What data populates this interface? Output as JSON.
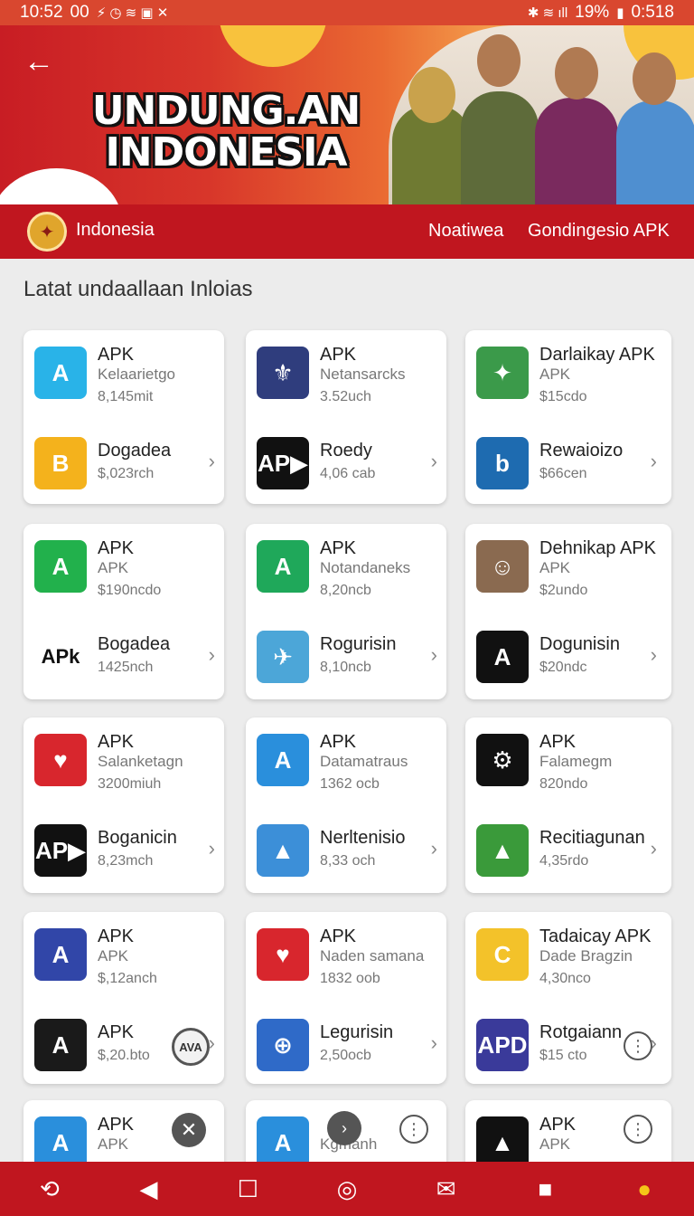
{
  "status": {
    "time": "10:52",
    "left_extra": "00",
    "battery": "19%",
    "right_time": "0:518"
  },
  "hero": {
    "title_line1": "UNDUNG.AN",
    "title_line2": "INDONESIA"
  },
  "nav": {
    "country": "Indonesia",
    "link1": "Noatiwea",
    "link2": "Gondingesio APK"
  },
  "section": {
    "title": "Latat undaallaan Inloias"
  },
  "cards": [
    {
      "r1": {
        "name": "APK",
        "sub": "Kelaarietgo",
        "meta": "8,145mit",
        "icon_label": "A",
        "color": "#29b3e8"
      },
      "r2": {
        "name": "Dogadea",
        "meta": "$,023rch",
        "icon_label": "B",
        "color": "#f4b21c"
      }
    },
    {
      "r1": {
        "name": "APK",
        "sub": "Netansarcks",
        "meta": "3.52uch",
        "icon_label": "⚜",
        "color": "#2f3d7d"
      },
      "r2": {
        "name": "Roedy",
        "meta": "4,06 cab",
        "icon_label": "AP▶",
        "color": "#111111"
      }
    },
    {
      "r1": {
        "name": "Darlaikay APK",
        "sub": "APK",
        "meta": "$15cdo",
        "icon_label": "✦",
        "color": "#3b9a4a"
      },
      "r2": {
        "name": "Rewaioizo",
        "meta": "$66cen",
        "icon_label": "b",
        "color": "#1e6bb0"
      }
    },
    {
      "r1": {
        "name": "APK",
        "sub": "APK",
        "meta": "$190ncdo",
        "icon_label": "A",
        "color": "#22b14c"
      },
      "r2": {
        "name": "Bogadea",
        "meta": "1425nch",
        "icon_label": "APk",
        "color": "#ffffff"
      }
    },
    {
      "r1": {
        "name": "APK",
        "sub": "Notandaneks",
        "meta": "8,20ncb",
        "icon_label": "A",
        "color": "#1fa85a"
      },
      "r2": {
        "name": "Rogurisin",
        "meta": "8,10ncb",
        "icon_label": "✈",
        "color": "#4ca6d8"
      }
    },
    {
      "r1": {
        "name": "Dehnikap APK",
        "sub": "APK",
        "meta": "$2undo",
        "icon_label": "☺",
        "color": "#8a6a50"
      },
      "r2": {
        "name": "Dogunisin",
        "meta": "$20ndc",
        "icon_label": "A",
        "color": "#111111"
      }
    },
    {
      "r1": {
        "name": "APK",
        "sub": "Salanketagn",
        "meta": "3200miuh",
        "icon_label": "♥",
        "color": "#d8262d"
      },
      "r2": {
        "name": "Boganicin",
        "meta": "8,23mch",
        "icon_label": "AP▶",
        "color": "#111111"
      }
    },
    {
      "r1": {
        "name": "APK",
        "sub": "Datamatraus",
        "meta": "1362 ocb",
        "icon_label": "A",
        "color": "#2a8fdc"
      },
      "r2": {
        "name": "Nerltenisio",
        "meta": "8,33 och",
        "icon_label": "▲",
        "color": "#3c8fd8"
      }
    },
    {
      "r1": {
        "name": "APK",
        "sub": "Falamegm",
        "meta": "820ndo",
        "icon_label": "⚙",
        "color": "#111111"
      },
      "r2": {
        "name": "Recitiagunan",
        "meta": "4,35rdo",
        "icon_label": "▲",
        "color": "#3a9a3a"
      }
    },
    {
      "r1": {
        "name": "APK",
        "sub": "APK",
        "meta": "$,12anch",
        "icon_label": "A",
        "color": "#3146a8"
      },
      "r2": {
        "name": "APK",
        "meta": "$,20.bto",
        "icon_label": "A",
        "color": "#1a1a1a"
      }
    },
    {
      "r1": {
        "name": "APK",
        "sub": "Naden samana",
        "meta": "1832 oob",
        "icon_label": "♥",
        "color": "#d8262d"
      },
      "r2": {
        "name": "Legurisin",
        "meta": "2,50ocb",
        "icon_label": "⊕",
        "color": "#2f6ac8"
      }
    },
    {
      "r1": {
        "name": "Tadaicay APK",
        "sub": "Dade Bragzin",
        "meta": "4,30nco",
        "icon_label": "C",
        "color": "#f3c22a"
      },
      "r2": {
        "name": "Rotgaiann",
        "meta": "$15 cto",
        "icon_label": "APD",
        "color": "#3a3a9a"
      }
    },
    {
      "r1": {
        "name": "APK",
        "sub": "APK",
        "meta": "",
        "icon_label": "A",
        "color": "#2a8fdc"
      }
    },
    {
      "r1": {
        "name": "",
        "sub": "Kgmanh",
        "meta": "",
        "icon_label": "A",
        "color": "#2a8fdc"
      }
    },
    {
      "r1": {
        "name": "APK",
        "sub": "APK",
        "meta": "",
        "icon_label": "▲",
        "color": "#111111"
      }
    }
  ],
  "badge_text": "AVA",
  "icons": {
    "back": "arrow-left-icon",
    "chevron": "chevron-right-icon",
    "close": "close-icon",
    "more": "more-vertical-icon",
    "next": "chevron-right-circle-icon"
  },
  "bottom_nav": [
    "sync-icon",
    "back-icon",
    "square-icon",
    "home-icon",
    "mail-icon",
    "stop-icon",
    "person-icon"
  ]
}
